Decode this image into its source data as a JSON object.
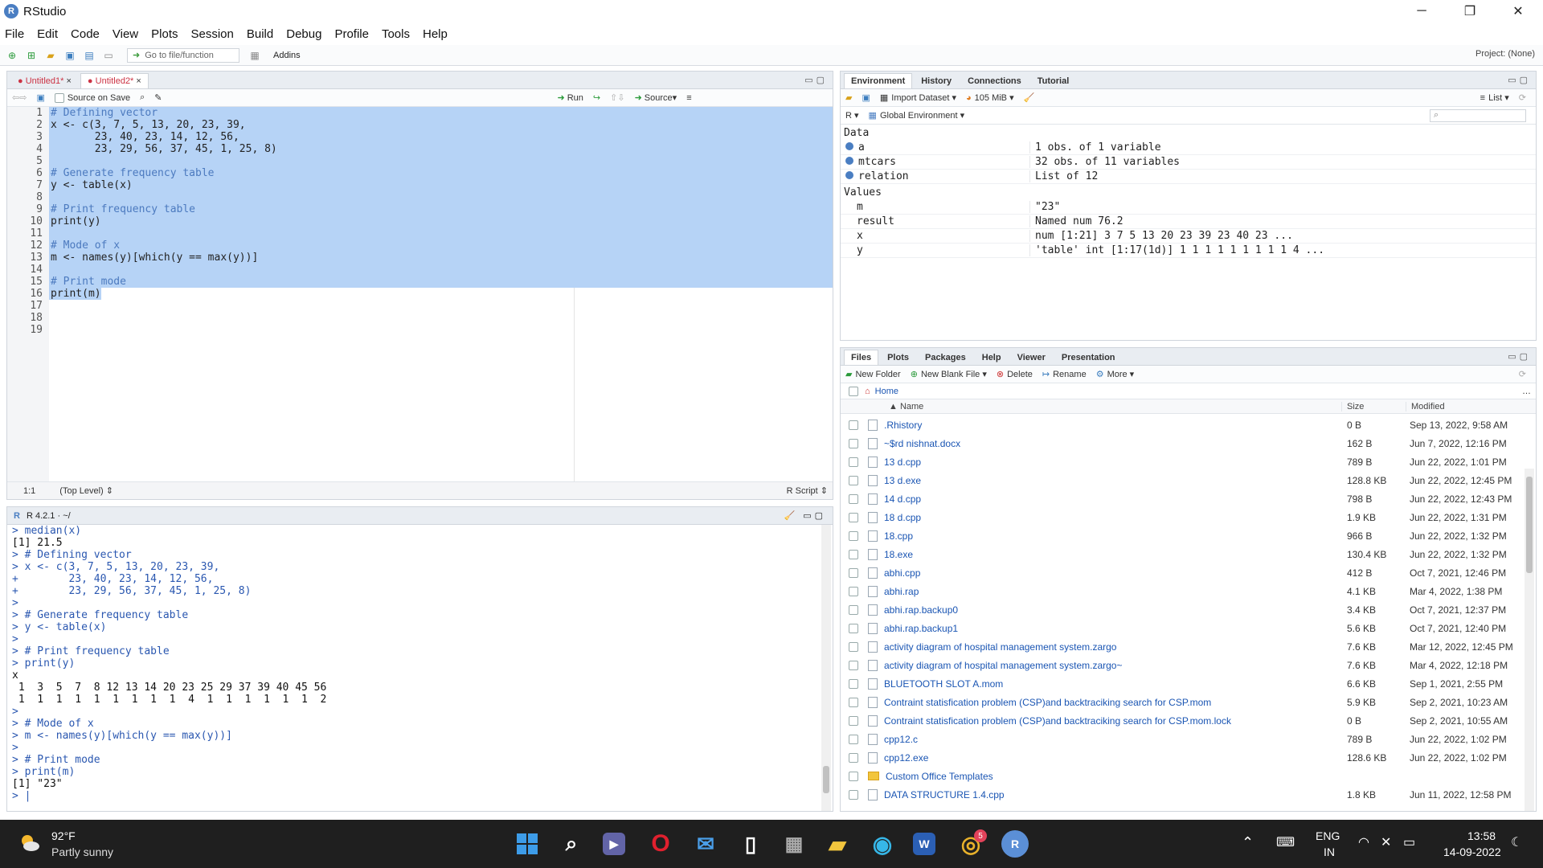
{
  "window": {
    "title": "RStudio",
    "logo": "R",
    "controls": [
      "─",
      "❐",
      "✕"
    ]
  },
  "menu": [
    "File",
    "Edit",
    "Code",
    "View",
    "Plots",
    "Session",
    "Build",
    "Debug",
    "Profile",
    "Tools",
    "Help"
  ],
  "toolbar": {
    "goto_placeholder": "Go to file/function",
    "addins": "Addins",
    "project": "Project: (None)"
  },
  "editor": {
    "tabs": [
      "Untitled1*",
      "Untitled2*"
    ],
    "source_on_save": "Source on Save",
    "run": "Run",
    "source": "Source",
    "lines": [
      "# Defining vector",
      "x <- c(3, 7, 5, 13, 20, 23, 39,",
      "       23, 40, 23, 14, 12, 56,",
      "       23, 29, 56, 37, 45, 1, 25, 8)",
      "",
      "# Generate frequency table",
      "y <- table(x)",
      "",
      "# Print frequency table",
      "print(y)",
      "",
      "# Mode of x",
      "m <- names(y)[which(y == max(y))]",
      "",
      "# Print mode",
      "print(m)",
      "",
      "",
      ""
    ],
    "line_numbers": [
      "1",
      "2",
      "3",
      "4",
      "5",
      "6",
      "7",
      "8",
      "9",
      "10",
      "11",
      "12",
      "13",
      "14",
      "15",
      "16",
      "17",
      "18",
      "19"
    ],
    "status_pos": "1:1",
    "status_scope": "(Top Level) ⇕",
    "status_type": "R Script ⇕"
  },
  "console": {
    "header": "R 4.2.1 · ~/",
    "lines": [
      {
        "t": "> median(x)",
        "k": "in"
      },
      {
        "t": "[1] 21.5",
        "k": "out"
      },
      {
        "t": "> # Defining vector",
        "k": "in"
      },
      {
        "t": "> x <- c(3, 7, 5, 13, 20, 23, 39,",
        "k": "in"
      },
      {
        "t": "+        23, 40, 23, 14, 12, 56,",
        "k": "in"
      },
      {
        "t": "+        23, 29, 56, 37, 45, 1, 25, 8)",
        "k": "in"
      },
      {
        "t": ">",
        "k": "in"
      },
      {
        "t": "> # Generate frequency table",
        "k": "in"
      },
      {
        "t": "> y <- table(x)",
        "k": "in"
      },
      {
        "t": ">",
        "k": "in"
      },
      {
        "t": "> # Print frequency table",
        "k": "in"
      },
      {
        "t": "> print(y)",
        "k": "in"
      },
      {
        "t": "x",
        "k": "out"
      },
      {
        "t": " 1  3  5  7  8 12 13 14 20 23 25 29 37 39 40 45 56",
        "k": "out"
      },
      {
        "t": " 1  1  1  1  1  1  1  1  1  4  1  1  1  1  1  1  2",
        "k": "out"
      },
      {
        "t": ">",
        "k": "in"
      },
      {
        "t": "> # Mode of x",
        "k": "in"
      },
      {
        "t": "> m <- names(y)[which(y == max(y))]",
        "k": "in"
      },
      {
        "t": ">",
        "k": "in"
      },
      {
        "t": "> # Print mode",
        "k": "in"
      },
      {
        "t": "> print(m)",
        "k": "in"
      },
      {
        "t": "[1] \"23\"",
        "k": "out"
      },
      {
        "t": "> |",
        "k": "in"
      }
    ]
  },
  "environment": {
    "tabs": [
      "Environment",
      "History",
      "Connections",
      "Tutorial"
    ],
    "import_dataset": "Import Dataset",
    "memory": "105 MiB",
    "list_view": "List",
    "lang": "R",
    "scope": "Global Environment",
    "data_label": "Data",
    "data": [
      {
        "name": "a",
        "value": "1 obs. of 1 variable"
      },
      {
        "name": "mtcars",
        "value": "32 obs. of 11 variables"
      },
      {
        "name": "relation",
        "value": "List of  12"
      }
    ],
    "values_label": "Values",
    "values": [
      {
        "name": "m",
        "value": "\"23\""
      },
      {
        "name": "result",
        "value": "Named num 76.2"
      },
      {
        "name": "x",
        "value": "num [1:21] 3 7 5 13 20 23 39 23 40 23 ..."
      },
      {
        "name": "y",
        "value": "'table' int [1:17(1d)] 1 1 1 1 1 1 1 1 1 4 ..."
      }
    ]
  },
  "files": {
    "tabs": [
      "Files",
      "Plots",
      "Packages",
      "Help",
      "Viewer",
      "Presentation"
    ],
    "new_folder": "New Folder",
    "new_blank_file": "New Blank File",
    "delete": "Delete",
    "rename": "Rename",
    "more": "More",
    "path": "Home",
    "col_name": "▲ Name",
    "col_size": "Size",
    "col_modified": "Modified",
    "rows": [
      {
        "name": ".Rhistory",
        "size": "0 B",
        "modified": "Sep 13, 2022, 9:58 AM"
      },
      {
        "name": "~$rd nishnat.docx",
        "size": "162 B",
        "modified": "Jun 7, 2022, 12:16 PM"
      },
      {
        "name": "13 d.cpp",
        "size": "789 B",
        "modified": "Jun 22, 2022, 1:01 PM"
      },
      {
        "name": "13 d.exe",
        "size": "128.8 KB",
        "modified": "Jun 22, 2022, 12:45 PM"
      },
      {
        "name": "14 d.cpp",
        "size": "798 B",
        "modified": "Jun 22, 2022, 12:43 PM"
      },
      {
        "name": "18 d.cpp",
        "size": "1.9 KB",
        "modified": "Jun 22, 2022, 1:31 PM"
      },
      {
        "name": "18.cpp",
        "size": "966 B",
        "modified": "Jun 22, 2022, 1:32 PM"
      },
      {
        "name": "18.exe",
        "size": "130.4 KB",
        "modified": "Jun 22, 2022, 1:32 PM"
      },
      {
        "name": "abhi.cpp",
        "size": "412 B",
        "modified": "Oct 7, 2021, 12:46 PM"
      },
      {
        "name": "abhi.rap",
        "size": "4.1 KB",
        "modified": "Mar 4, 2022, 1:38 PM"
      },
      {
        "name": "abhi.rap.backup0",
        "size": "3.4 KB",
        "modified": "Oct 7, 2021, 12:37 PM"
      },
      {
        "name": "abhi.rap.backup1",
        "size": "5.6 KB",
        "modified": "Oct 7, 2021, 12:40 PM"
      },
      {
        "name": "activity diagram of hospital management system.zargo",
        "size": "7.6 KB",
        "modified": "Mar 12, 2022, 12:45 PM"
      },
      {
        "name": "activity diagram of hospital management system.zargo~",
        "size": "7.6 KB",
        "modified": "Mar 4, 2022, 12:18 PM"
      },
      {
        "name": "BLUETOOTH SLOT A.mom",
        "size": "6.6 KB",
        "modified": "Sep 1, 2021, 2:55 PM"
      },
      {
        "name": "Contraint statisfication problem (CSP)and backtraciking search for CSP.mom",
        "size": "5.9 KB",
        "modified": "Sep 2, 2021, 10:23 AM"
      },
      {
        "name": "Contraint statisfication problem (CSP)and backtraciking search for CSP.mom.lock",
        "size": "0 B",
        "modified": "Sep 2, 2021, 10:55 AM"
      },
      {
        "name": "cpp12.c",
        "size": "789 B",
        "modified": "Jun 22, 2022, 1:02 PM"
      },
      {
        "name": "cpp12.exe",
        "size": "128.6 KB",
        "modified": "Jun 22, 2022, 1:02 PM"
      },
      {
        "name": "Custom Office Templates",
        "size": "",
        "modified": ""
      },
      {
        "name": "DATA STRUCTURE 1.4.cpp",
        "size": "1.8 KB",
        "modified": "Jun 11, 2022, 12:58 PM"
      }
    ]
  },
  "taskbar": {
    "temp": "92°F",
    "weather": "Partly sunny",
    "lang1": "ENG",
    "lang2": "IN",
    "time": "13:58",
    "date": "14-09-2022",
    "badge": "5"
  },
  "colors": {
    "accent": "#4a7ec2",
    "selection": "#b6d3f6",
    "comment": "#4c7abf",
    "console_input": "#2a57b0"
  }
}
